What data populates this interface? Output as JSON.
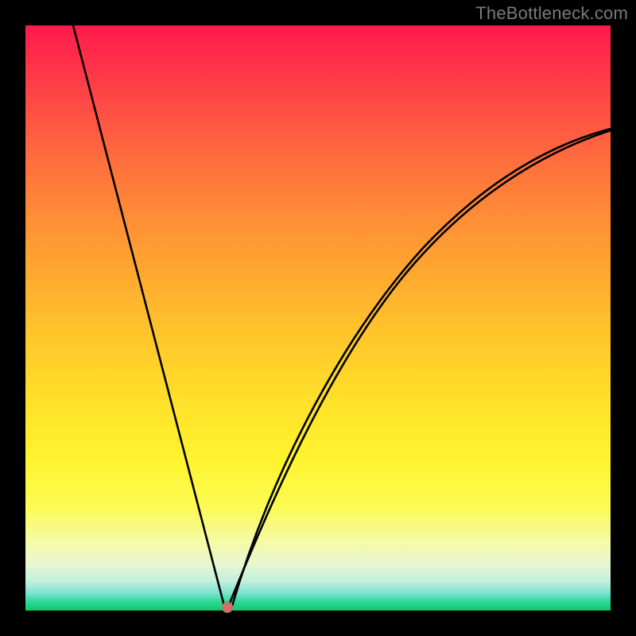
{
  "attribution": "TheBottleneck.com",
  "chart_data": {
    "type": "line",
    "title": "",
    "xlabel": "",
    "ylabel": "",
    "xlim": [
      0,
      100
    ],
    "ylim": [
      0,
      100
    ],
    "x": [
      8,
      10,
      12,
      14,
      16,
      18,
      20,
      22,
      24,
      26,
      28,
      30,
      32,
      33,
      34,
      35,
      36,
      40,
      44,
      48,
      52,
      56,
      60,
      64,
      68,
      72,
      76,
      80,
      84,
      88,
      92,
      96,
      100
    ],
    "values": [
      100,
      92,
      84,
      76,
      68,
      60,
      52,
      44,
      36,
      28,
      20,
      12,
      5,
      2,
      0,
      2,
      5,
      14,
      22,
      29,
      35,
      41,
      46,
      50,
      54,
      57,
      60,
      62,
      64,
      66,
      68,
      70,
      72
    ],
    "vertex": {
      "x": 34,
      "y": 0
    },
    "gradient_meaning": "background hue maps to y-value (top=worst, bottom=best)",
    "gradient_stops": [
      {
        "pos": 0,
        "color": "#ff1a4b"
      },
      {
        "pos": 50,
        "color": "#ffcb2a"
      },
      {
        "pos": 80,
        "color": "#fbfb50"
      },
      {
        "pos": 100,
        "color": "#13c763"
      }
    ]
  }
}
